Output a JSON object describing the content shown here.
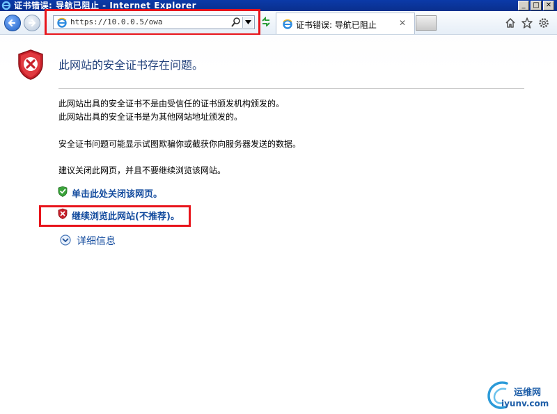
{
  "window": {
    "title": "证书错误: 导航已阻止 - Internet Explorer"
  },
  "address_bar": {
    "url": "https://10.0.0.5/owa"
  },
  "tab": {
    "label": "证书错误: 导航已阻止",
    "close": "✕"
  },
  "page": {
    "heading": "此网站的安全证书存在问题。",
    "lines": [
      "此网站出具的安全证书不是由受信任的证书颁发机构颁发的。",
      "此网站出具的安全证书是为其他网站地址颁发的。",
      "安全证书问题可能显示试图欺骗你或截获你向服务器发送的数据。",
      "建议关闭此网页，并且不要继续浏览该网站。"
    ],
    "close_link": "单击此处关闭该网页。",
    "continue_link": "继续浏览此网站(不推荐)。",
    "more_info": "详细信息"
  },
  "watermark": {
    "brand": "运维网",
    "domain": "iyunv.com"
  }
}
